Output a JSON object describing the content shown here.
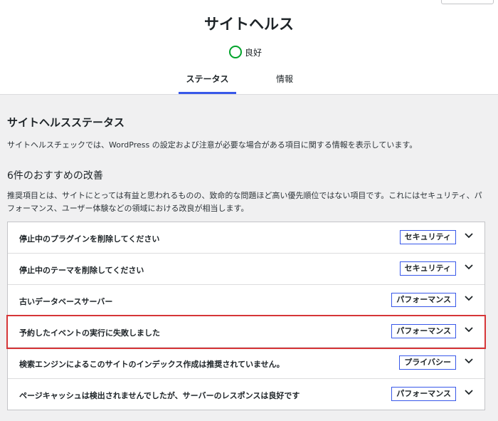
{
  "header": {
    "title": "サイトヘルス",
    "status_label": "良好"
  },
  "tabs": [
    {
      "label": "ステータス",
      "active": true
    },
    {
      "label": "情報",
      "active": false
    }
  ],
  "main": {
    "section_title": "サイトヘルスステータス",
    "section_description": "サイトヘルスチェックでは、WordPress の設定および注意が必要な場合がある項目に関する情報を表示しています。",
    "recommended_title": "6件のおすすめの改善",
    "recommended_description": "推奨項目とは、サイトにとっては有益と思われるものの、致命的な問題ほど高い優先順位ではない項目です。これにはセキュリティ、パフォーマンス、ユーザー体験などの領域における改良が相当します。",
    "issues": [
      {
        "label": "停止中のプラグインを削除してください",
        "badge": "セキュリティ"
      },
      {
        "label": "停止中のテーマを削除してください",
        "badge": "セキュリティ"
      },
      {
        "label": "古いデータベースサーバー",
        "badge": "パフォーマンス"
      },
      {
        "label": "予約したイベントの実行に失敗しました",
        "badge": "パフォーマンス"
      },
      {
        "label": "検索エンジンによるこのサイトのインデックス作成は推奨されていません。",
        "badge": "プライバシー"
      },
      {
        "label": "ページキャッシュは検出されませんでしたが、サーバーのレスポンスは良好です",
        "badge": "パフォーマンス"
      }
    ]
  },
  "colors": {
    "accent": "#3858e9",
    "good": "#00a32a",
    "highlight": "#d63638"
  }
}
